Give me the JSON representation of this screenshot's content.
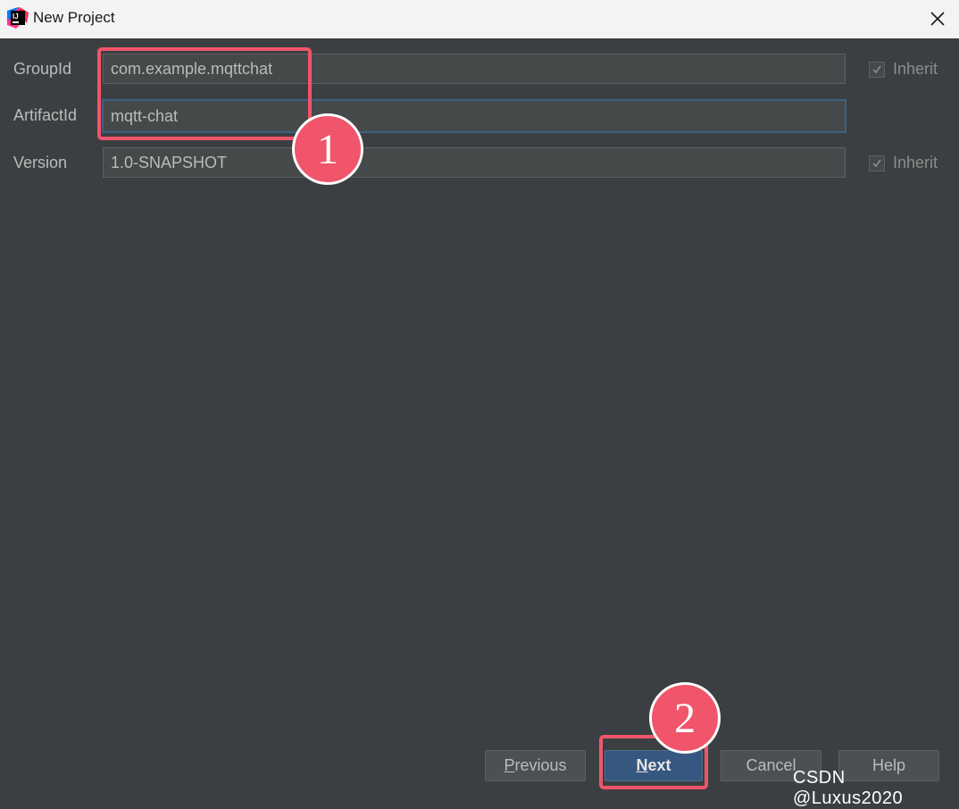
{
  "window": {
    "title": "New Project",
    "icon": "intellij-idea-icon"
  },
  "form": {
    "group_id": {
      "label": "GroupId",
      "value": "com.example.mqttchat",
      "inherit_label": "Inherit",
      "inherit_checked": true
    },
    "artifact_id": {
      "label": "ArtifactId",
      "value": "mqtt-chat"
    },
    "version": {
      "label": "Version",
      "value": "1.0-SNAPSHOT",
      "inherit_label": "Inherit",
      "inherit_checked": true
    }
  },
  "buttons": {
    "previous_rest": "revious",
    "previous_mnemonic": "P",
    "next_rest": "ext",
    "next_mnemonic": "N",
    "cancel": "Cancel",
    "help": "Help"
  },
  "annotations": {
    "step1": "1",
    "step2": "2",
    "color": "#f0556b"
  },
  "watermark": "CSDN @Luxus2020"
}
